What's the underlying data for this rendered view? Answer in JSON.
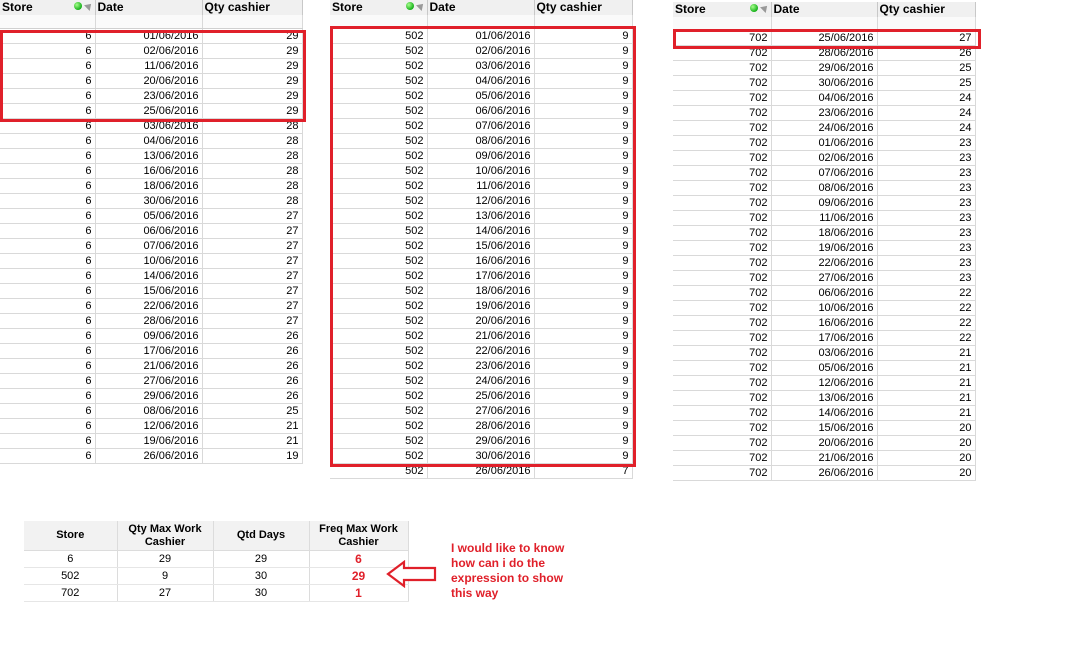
{
  "headers": {
    "store": "Store",
    "date": "Date",
    "qty": "Qty cashier"
  },
  "tables": [
    {
      "rows": [
        [
          "6",
          "01/06/2016",
          "29"
        ],
        [
          "6",
          "02/06/2016",
          "29"
        ],
        [
          "6",
          "11/06/2016",
          "29"
        ],
        [
          "6",
          "20/06/2016",
          "29"
        ],
        [
          "6",
          "23/06/2016",
          "29"
        ],
        [
          "6",
          "25/06/2016",
          "29"
        ],
        [
          "6",
          "03/06/2016",
          "28"
        ],
        [
          "6",
          "04/06/2016",
          "28"
        ],
        [
          "6",
          "13/06/2016",
          "28"
        ],
        [
          "6",
          "16/06/2016",
          "28"
        ],
        [
          "6",
          "18/06/2016",
          "28"
        ],
        [
          "6",
          "30/06/2016",
          "28"
        ],
        [
          "6",
          "05/06/2016",
          "27"
        ],
        [
          "6",
          "06/06/2016",
          "27"
        ],
        [
          "6",
          "07/06/2016",
          "27"
        ],
        [
          "6",
          "10/06/2016",
          "27"
        ],
        [
          "6",
          "14/06/2016",
          "27"
        ],
        [
          "6",
          "15/06/2016",
          "27"
        ],
        [
          "6",
          "22/06/2016",
          "27"
        ],
        [
          "6",
          "28/06/2016",
          "27"
        ],
        [
          "6",
          "09/06/2016",
          "26"
        ],
        [
          "6",
          "17/06/2016",
          "26"
        ],
        [
          "6",
          "21/06/2016",
          "26"
        ],
        [
          "6",
          "27/06/2016",
          "26"
        ],
        [
          "6",
          "29/06/2016",
          "26"
        ],
        [
          "6",
          "08/06/2016",
          "25"
        ],
        [
          "6",
          "12/06/2016",
          "21"
        ],
        [
          "6",
          "19/06/2016",
          "21"
        ],
        [
          "6",
          "26/06/2016",
          "19"
        ]
      ]
    },
    {
      "rows": [
        [
          "502",
          "01/06/2016",
          "9"
        ],
        [
          "502",
          "02/06/2016",
          "9"
        ],
        [
          "502",
          "03/06/2016",
          "9"
        ],
        [
          "502",
          "04/06/2016",
          "9"
        ],
        [
          "502",
          "05/06/2016",
          "9"
        ],
        [
          "502",
          "06/06/2016",
          "9"
        ],
        [
          "502",
          "07/06/2016",
          "9"
        ],
        [
          "502",
          "08/06/2016",
          "9"
        ],
        [
          "502",
          "09/06/2016",
          "9"
        ],
        [
          "502",
          "10/06/2016",
          "9"
        ],
        [
          "502",
          "11/06/2016",
          "9"
        ],
        [
          "502",
          "12/06/2016",
          "9"
        ],
        [
          "502",
          "13/06/2016",
          "9"
        ],
        [
          "502",
          "14/06/2016",
          "9"
        ],
        [
          "502",
          "15/06/2016",
          "9"
        ],
        [
          "502",
          "16/06/2016",
          "9"
        ],
        [
          "502",
          "17/06/2016",
          "9"
        ],
        [
          "502",
          "18/06/2016",
          "9"
        ],
        [
          "502",
          "19/06/2016",
          "9"
        ],
        [
          "502",
          "20/06/2016",
          "9"
        ],
        [
          "502",
          "21/06/2016",
          "9"
        ],
        [
          "502",
          "22/06/2016",
          "9"
        ],
        [
          "502",
          "23/06/2016",
          "9"
        ],
        [
          "502",
          "24/06/2016",
          "9"
        ],
        [
          "502",
          "25/06/2016",
          "9"
        ],
        [
          "502",
          "27/06/2016",
          "9"
        ],
        [
          "502",
          "28/06/2016",
          "9"
        ],
        [
          "502",
          "29/06/2016",
          "9"
        ],
        [
          "502",
          "30/06/2016",
          "9"
        ],
        [
          "502",
          "26/06/2016",
          "7"
        ]
      ]
    },
    {
      "rows": [
        [
          "702",
          "25/06/2016",
          "27"
        ],
        [
          "702",
          "28/06/2016",
          "26"
        ],
        [
          "702",
          "29/06/2016",
          "25"
        ],
        [
          "702",
          "30/06/2016",
          "25"
        ],
        [
          "702",
          "04/06/2016",
          "24"
        ],
        [
          "702",
          "23/06/2016",
          "24"
        ],
        [
          "702",
          "24/06/2016",
          "24"
        ],
        [
          "702",
          "01/06/2016",
          "23"
        ],
        [
          "702",
          "02/06/2016",
          "23"
        ],
        [
          "702",
          "07/06/2016",
          "23"
        ],
        [
          "702",
          "08/06/2016",
          "23"
        ],
        [
          "702",
          "09/06/2016",
          "23"
        ],
        [
          "702",
          "11/06/2016",
          "23"
        ],
        [
          "702",
          "18/06/2016",
          "23"
        ],
        [
          "702",
          "19/06/2016",
          "23"
        ],
        [
          "702",
          "22/06/2016",
          "23"
        ],
        [
          "702",
          "27/06/2016",
          "23"
        ],
        [
          "702",
          "06/06/2016",
          "22"
        ],
        [
          "702",
          "10/06/2016",
          "22"
        ],
        [
          "702",
          "16/06/2016",
          "22"
        ],
        [
          "702",
          "17/06/2016",
          "22"
        ],
        [
          "702",
          "03/06/2016",
          "21"
        ],
        [
          "702",
          "05/06/2016",
          "21"
        ],
        [
          "702",
          "12/06/2016",
          "21"
        ],
        [
          "702",
          "13/06/2016",
          "21"
        ],
        [
          "702",
          "14/06/2016",
          "21"
        ],
        [
          "702",
          "15/06/2016",
          "20"
        ],
        [
          "702",
          "20/06/2016",
          "20"
        ],
        [
          "702",
          "21/06/2016",
          "20"
        ],
        [
          "702",
          "26/06/2016",
          "20"
        ]
      ]
    }
  ],
  "summary": {
    "headers": [
      "Store",
      "Qty Max Work Cashier",
      "Qtd Days",
      "Freq Max Work Cashier"
    ],
    "rows": [
      [
        "6",
        "29",
        "29",
        "6"
      ],
      [
        "502",
        "9",
        "30",
        "29"
      ],
      [
        "702",
        "27",
        "30",
        "1"
      ]
    ]
  },
  "note": "I would like to know how can i do the expression to show this way",
  "colors": {
    "highlight": "#e0202a",
    "indicator": "#16b01a"
  },
  "icons": [
    "green-dot-icon",
    "sort-indicator-icon",
    "left-arrow-icon"
  ]
}
